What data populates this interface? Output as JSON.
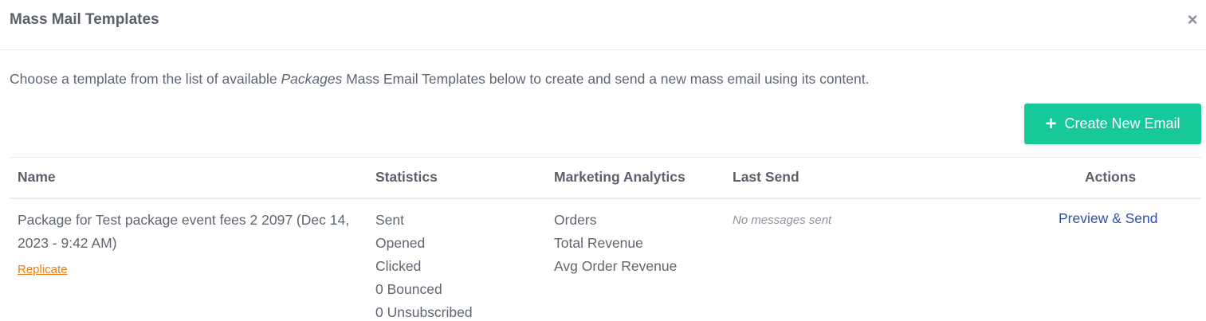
{
  "modal": {
    "title": "Mass Mail Templates",
    "close_symbol": "×"
  },
  "intro": {
    "before": "Choose a template from the list of available ",
    "emphasis": "Packages",
    "after": " Mass Email Templates below to create and send a new mass email using its content."
  },
  "toolbar": {
    "create_label": "Create New Email",
    "create_icon": "plus-icon"
  },
  "table": {
    "headers": {
      "name": "Name",
      "statistics": "Statistics",
      "marketing": "Marketing Analytics",
      "last_send": "Last Send",
      "actions": "Actions"
    },
    "rows": [
      {
        "name": "Package for Test package event fees 2 2097 (Dec 14, 2023 - 9:42 AM)",
        "replicate_label": "Replicate",
        "statistics": [
          "Sent",
          "Opened",
          "Clicked",
          "0 Bounced",
          "0 Unsubscribed"
        ],
        "marketing": [
          "Orders",
          "Total Revenue",
          "Avg Order Revenue"
        ],
        "last_send": "No messages sent",
        "action_label": "Preview & Send"
      }
    ]
  },
  "colors": {
    "accent": "#17c99a",
    "link": "#2f4fa8",
    "replicate": "#f07a12"
  }
}
